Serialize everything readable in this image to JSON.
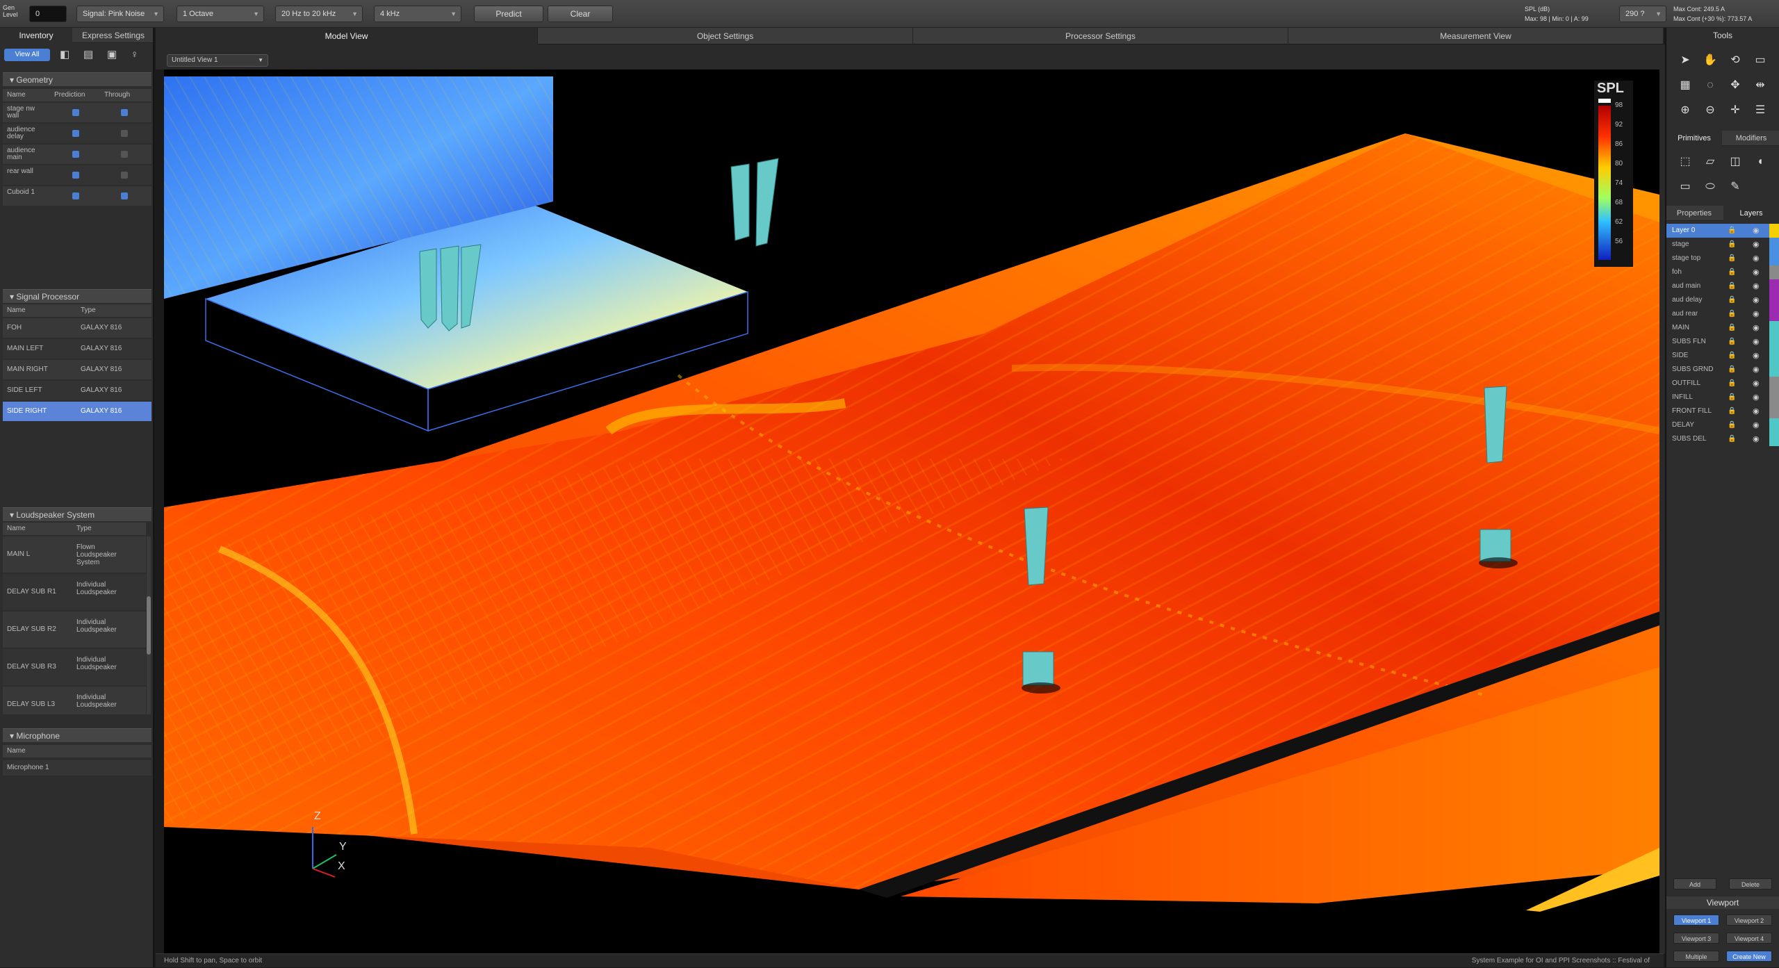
{
  "toolbar": {
    "gen_label": "Gen\nLevel",
    "gen_value": "0",
    "signal": "Signal: Pink Noise",
    "bandwidth": "1 Octave",
    "frequency_range": "20 Hz to 20 kHz",
    "center_freq": "4 kHz",
    "predict_label": "Predict",
    "clear_label": "Clear",
    "spl_info_1": "SPL (dB)",
    "spl_info_2": "Max: 98 | Min: 0 | A: 99",
    "zoom": "290 ?",
    "max_cont_1": "Max Cont: 249.5 A",
    "max_cont_2": "Max Cont (+30 %): 773.57 A"
  },
  "left": {
    "tabs": [
      "Inventory",
      "Express Settings"
    ],
    "view_all_label": "View All",
    "geometry": {
      "title": "Geometry",
      "headers": [
        "Name",
        "Prediction",
        "Through"
      ],
      "rows": [
        {
          "name": "stage nw wall",
          "prediction": true,
          "through": true
        },
        {
          "name": "audience delay",
          "prediction": true,
          "through": false
        },
        {
          "name": "audience main",
          "prediction": true,
          "through": false
        },
        {
          "name": "rear wall",
          "prediction": true,
          "through": false
        },
        {
          "name": "Cuboid 1",
          "prediction": true,
          "through": true
        }
      ]
    },
    "signal_processor": {
      "title": "Signal Processor",
      "headers": [
        "Name",
        "Type"
      ],
      "rows": [
        {
          "name": "FOH",
          "type": "GALAXY 816",
          "selected": false
        },
        {
          "name": "MAIN LEFT",
          "type": "GALAXY 816",
          "selected": false
        },
        {
          "name": "MAIN RIGHT",
          "type": "GALAXY 816",
          "selected": false
        },
        {
          "name": "SIDE LEFT",
          "type": "GALAXY 816",
          "selected": false
        },
        {
          "name": "SIDE RIGHT",
          "type": "GALAXY 816",
          "selected": true
        }
      ]
    },
    "loudspeaker": {
      "title": "Loudspeaker System",
      "headers": [
        "Name",
        "Type"
      ],
      "rows": [
        {
          "name": "MAIN L",
          "type": "Flown Loudspeaker System"
        },
        {
          "name": "DELAY SUB R1",
          "type": "Individual Loudspeaker"
        },
        {
          "name": "DELAY SUB R2",
          "type": "Individual Loudspeaker"
        },
        {
          "name": "DELAY SUB R3",
          "type": "Individual Loudspeaker"
        },
        {
          "name": "DELAY SUB L3",
          "type": "Individual Loudspeaker"
        }
      ]
    },
    "microphone": {
      "title": "Microphone",
      "headers": [
        "Name"
      ],
      "rows": [
        {
          "name": "Microphone 1"
        }
      ]
    }
  },
  "view_tabs": [
    "Model View",
    "Object Settings",
    "Processor Settings",
    "Measurement View"
  ],
  "view_dropdown": "Untitled View 1",
  "legend": {
    "title": "SPL",
    "ticks": [
      "98",
      "92",
      "86",
      "80",
      "74",
      "68",
      "62",
      "56"
    ]
  },
  "axes": {
    "z": "Z",
    "y": "Y",
    "x": "X"
  },
  "status": {
    "left": "Hold Shift to pan, Space to orbit",
    "right": "System Example for OI and PPI Screenshots :: Festival of"
  },
  "right": {
    "tools_title": "Tools",
    "tabs_a": [
      "Primitives",
      "Modifiers"
    ],
    "tabs_b": [
      "Properties",
      "Layers"
    ],
    "layers": [
      {
        "name": "Layer 0",
        "color": "#f5d000",
        "selected": true
      },
      {
        "name": "stage",
        "color": "#4a90e0"
      },
      {
        "name": "stage top",
        "color": "#4a90e0"
      },
      {
        "name": "foh",
        "color": "#8a8a8a"
      },
      {
        "name": "aud main",
        "color": "#9b2bb0"
      },
      {
        "name": "aud delay",
        "color": "#9b2bb0"
      },
      {
        "name": "aud rear",
        "color": "#9b2bb0"
      },
      {
        "name": "MAIN",
        "color": "#4fc7c7"
      },
      {
        "name": "SUBS FLN",
        "color": "#4fc7c7"
      },
      {
        "name": "SIDE",
        "color": "#4fc7c7"
      },
      {
        "name": "SUBS GRND",
        "color": "#4fc7c7"
      },
      {
        "name": "OUTFILL",
        "color": "#8a8a8a"
      },
      {
        "name": "INFILL",
        "color": "#8a8a8a"
      },
      {
        "name": "FRONT FILL",
        "color": "#8a8a8a"
      },
      {
        "name": "DELAY",
        "color": "#4fc7c7"
      },
      {
        "name": "SUBS DEL",
        "color": "#4fc7c7"
      }
    ],
    "add_label": "Add",
    "delete_label": "Delete",
    "viewport_title": "Viewport",
    "viewports": [
      "Viewport 1",
      "Viewport 2",
      "Viewport 3",
      "Viewport 4"
    ],
    "multiple_label": "Multiple",
    "create_new_label": "Create New"
  },
  "colors": {
    "accent": "#5b84d8",
    "spl_high": "#ff3300",
    "spl_mid": "#ffcc00",
    "spl_low": "#1f4fe0"
  }
}
